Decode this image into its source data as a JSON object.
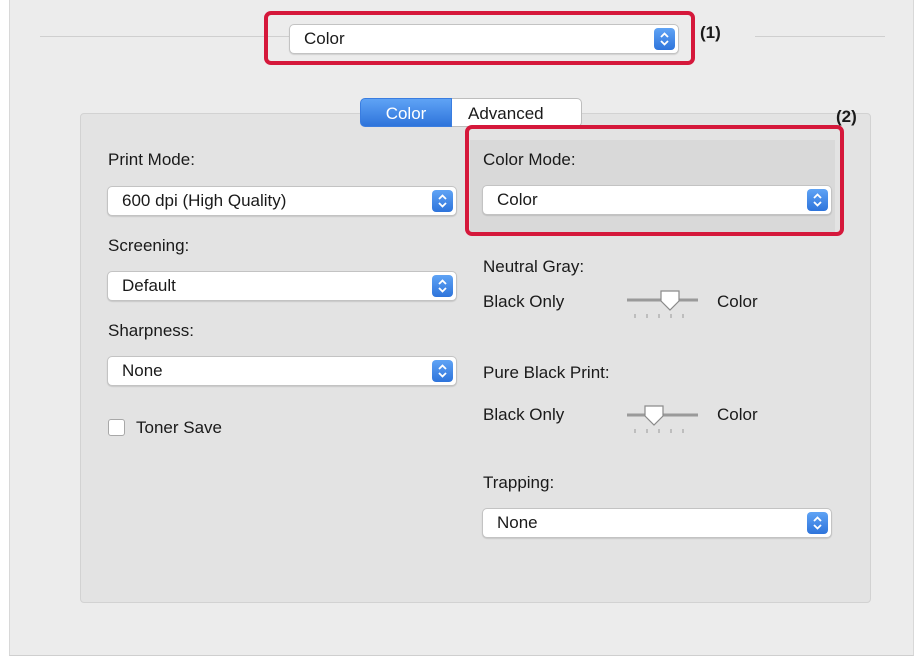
{
  "top_selector": {
    "value": "Color",
    "callout": "(1)"
  },
  "tabs": [
    {
      "label": "Color",
      "active": true
    },
    {
      "label": "Advanced",
      "active": false
    }
  ],
  "color_mode_callout": "(2)",
  "left_column": {
    "print_mode": {
      "label": "Print Mode:",
      "value": "600 dpi (High Quality)"
    },
    "screening": {
      "label": "Screening:",
      "value": "Default"
    },
    "sharpness": {
      "label": "Sharpness:",
      "value": "None"
    },
    "toner_save": {
      "label": "Toner Save",
      "checked": false
    }
  },
  "right_column": {
    "color_mode": {
      "label": "Color Mode:",
      "value": "Color"
    },
    "neutral_gray": {
      "label": "Neutral Gray:",
      "left": "Black Only",
      "right": "Color"
    },
    "pure_black_print": {
      "label": "Pure Black Print:",
      "left": "Black Only",
      "right": "Color"
    },
    "trapping": {
      "label": "Trapping:",
      "value": "None"
    }
  },
  "colors": {
    "accent": "#2e74db",
    "highlight": "#d5183b",
    "panel": "#e3e3e3",
    "window": "#ececec"
  },
  "icons": [
    "popup-stepper-icon",
    "slider-thumb-icon",
    "checkbox-icon"
  ]
}
